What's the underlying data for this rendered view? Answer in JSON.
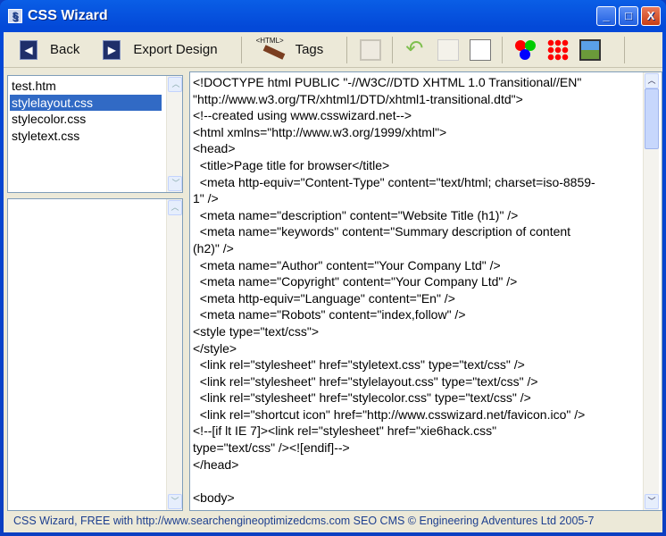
{
  "window": {
    "title": "CSS Wizard",
    "minimize": "_",
    "maximize": "□",
    "close": "X"
  },
  "toolbar": {
    "back": "Back",
    "export": "Export Design",
    "tags": "Tags",
    "tags_icon_text": "<HTML>"
  },
  "files": [
    {
      "name": "test.htm",
      "selected": false
    },
    {
      "name": "stylelayout.css",
      "selected": true
    },
    {
      "name": "stylecolor.css",
      "selected": false
    },
    {
      "name": "styletext.css",
      "selected": false
    }
  ],
  "editor": {
    "lines": [
      "<!DOCTYPE html PUBLIC \"-//W3C//DTD XHTML 1.0 Transitional//EN\"",
      "\"http://www.w3.org/TR/xhtml1/DTD/xhtml1-transitional.dtd\">",
      "<!--created using www.csswizard.net-->",
      "<html xmlns=\"http://www.w3.org/1999/xhtml\">",
      "<head>",
      "  <title>Page title for browser</title>",
      "  <meta http-equiv=\"Content-Type\" content=\"text/html; charset=iso-8859-",
      "1\" />",
      "  <meta name=\"description\" content=\"Website Title (h1)\" />",
      "  <meta name=\"keywords\" content=\"Summary description of content",
      "(h2)\" />",
      "  <meta name=\"Author\" content=\"Your Company Ltd\" />",
      "  <meta name=\"Copyright\" content=\"Your Company Ltd\" />",
      "  <meta http-equiv=\"Language\" content=\"En\" />",
      "  <meta name=\"Robots\" content=\"index,follow\" />",
      "<style type=\"text/css\">",
      "</style>",
      "  <link rel=\"stylesheet\" href=\"styletext.css\" type=\"text/css\" />",
      "  <link rel=\"stylesheet\" href=\"stylelayout.css\" type=\"text/css\" />",
      "  <link rel=\"stylesheet\" href=\"stylecolor.css\" type=\"text/css\" />",
      "  <link rel=\"shortcut icon\" href=\"http://www.csswizard.net/favicon.ico\" />",
      "<!--[if lt IE 7]><link rel=\"stylesheet\" href=\"xie6hack.css\"",
      "type=\"text/css\" /><![endif]-->",
      "</head>",
      "",
      "<body>"
    ]
  },
  "status": "CSS Wizard, FREE with http://www.searchengineoptimizedcms.com SEO CMS © Engineering Adventures Ltd 2005-7"
}
